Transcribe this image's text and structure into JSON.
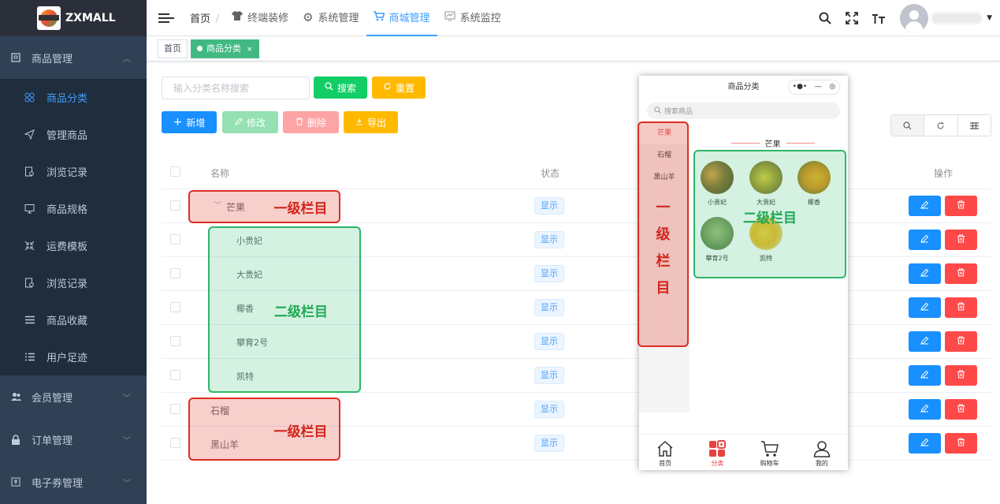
{
  "app": {
    "logo_text": "ZXMALL"
  },
  "sidebar": {
    "groups": [
      {
        "label": "商品管理",
        "icon": "square-icon"
      },
      {
        "label": "会员管理",
        "icon": "users-icon"
      },
      {
        "label": "订单管理",
        "icon": "lock-icon"
      },
      {
        "label": "电子券管理",
        "icon": "coupon-icon"
      }
    ],
    "items": [
      {
        "label": "商品分类",
        "icon": "clover-icon",
        "active": true
      },
      {
        "label": "管理商品",
        "icon": "send-icon"
      },
      {
        "label": "浏览记录",
        "icon": "doc-search-icon"
      },
      {
        "label": "商品规格",
        "icon": "monitor-icon"
      },
      {
        "label": "运费模板",
        "icon": "shrink-icon"
      },
      {
        "label": "浏览记录",
        "icon": "doc-search-icon"
      },
      {
        "label": "商品收藏",
        "icon": "list-icon"
      },
      {
        "label": "用户足迹",
        "icon": "list-icon"
      }
    ]
  },
  "topbar": {
    "home": "首页",
    "sep": "/",
    "nav": [
      {
        "label": "终端装修",
        "icon": "shirt-icon"
      },
      {
        "label": "系统管理",
        "icon": "gear-icon"
      },
      {
        "label": "商城管理",
        "icon": "cart-icon",
        "active": true
      },
      {
        "label": "系统监控",
        "icon": "chart-icon"
      }
    ]
  },
  "tags": [
    {
      "label": "首页"
    },
    {
      "label": "商品分类",
      "active": true,
      "close": "×"
    }
  ],
  "search": {
    "placeholder": "输入分类名称搜索",
    "search_label": "搜索",
    "reset_label": "重置"
  },
  "actions": {
    "add": "新增",
    "edit": "修改",
    "delete": "删除",
    "export": "导出"
  },
  "table": {
    "headers": {
      "name": "名称",
      "status": "状态",
      "ops": "操作"
    },
    "rows": [
      {
        "name": "芒果",
        "status": "显示",
        "level": 1,
        "expanded": true
      },
      {
        "name": "小贵妃",
        "status": "显示",
        "level": 2
      },
      {
        "name": "大贵妃",
        "status": "显示",
        "level": 2
      },
      {
        "name": "椰香",
        "status": "显示",
        "level": 2
      },
      {
        "name": "攀育2号",
        "status": "显示",
        "level": 2
      },
      {
        "name": "凯特",
        "status": "显示",
        "level": 2
      },
      {
        "name": "石榴",
        "status": "显示",
        "level": 1
      },
      {
        "name": "黑山羊",
        "status": "显示",
        "level": 1
      }
    ]
  },
  "annotations": {
    "level1": "一级栏目",
    "level2": "二级栏目",
    "level1_vertical": [
      "一",
      "级",
      "栏",
      "目"
    ]
  },
  "phone": {
    "title": "商品分类",
    "caps_dots": "•●•",
    "caps_minus": "—",
    "caps_target": "◎",
    "search_placeholder": "搜索商品",
    "categories": [
      {
        "label": "芒果",
        "active": true
      },
      {
        "label": "石榴"
      },
      {
        "label": "黑山羊"
      }
    ],
    "section_title": "芒果",
    "fruits": [
      {
        "label": "小贵妃",
        "color": "#8a6a2c"
      },
      {
        "label": "大贵妃",
        "color": "#c9b23a"
      },
      {
        "label": "椰香",
        "color": "#e0a020"
      },
      {
        "label": "攀育2号",
        "color": "#7fa060"
      },
      {
        "label": "凯特",
        "color": "#f0b820"
      }
    ],
    "tabs": [
      {
        "label": "首页",
        "icon": "home-icon"
      },
      {
        "label": "分类",
        "icon": "grid-icon",
        "active": true
      },
      {
        "label": "购物车",
        "icon": "cart-icon"
      },
      {
        "label": "我的",
        "icon": "user-icon"
      }
    ]
  },
  "colors": {
    "sidebar_bg": "#304156",
    "accent": "#409eff",
    "tag_active": "#42b983",
    "annotation_red": "#dd2e23",
    "annotation_green": "#2fb56a"
  }
}
